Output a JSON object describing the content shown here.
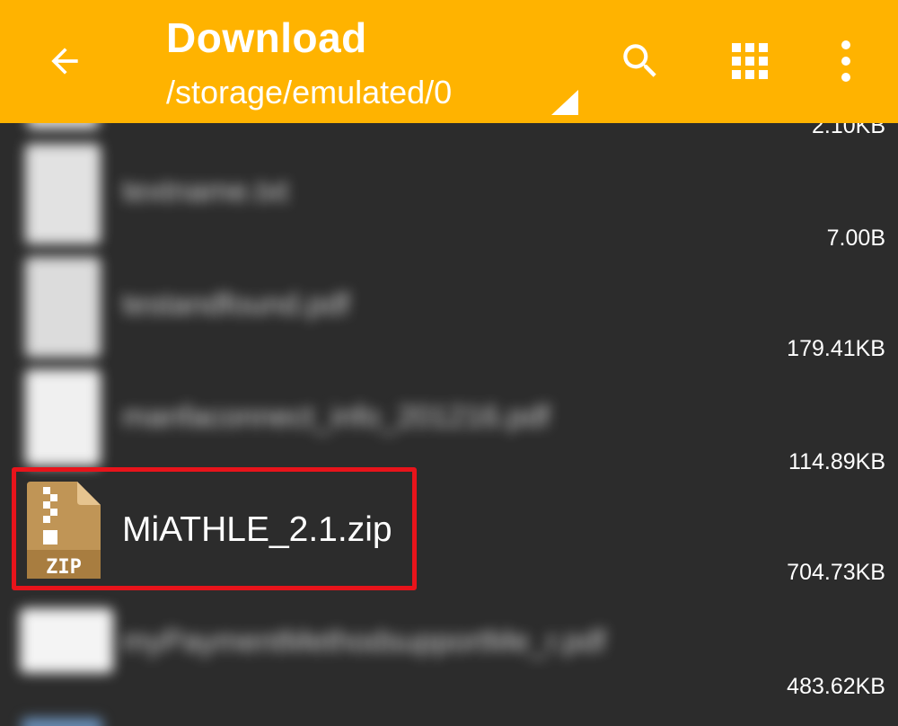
{
  "header": {
    "title": "Download",
    "path": "/storage/emulated/0",
    "back_icon": "arrow-back-icon",
    "search_icon": "search-icon",
    "view_icon": "grid-view-icon",
    "more_icon": "more-vert-icon",
    "accent_color": "#ffb300"
  },
  "files": [
    {
      "name": "",
      "size": "2.10KB",
      "blurred": true
    },
    {
      "name": "textname.txt",
      "size": "7.00B",
      "blurred": true
    },
    {
      "name": "testandfound.pdf",
      "size": "179.41KB",
      "blurred": true
    },
    {
      "name": "manfaconnect_info_201216.pdf",
      "size": "114.89KB",
      "blurred": true
    },
    {
      "name": "MiATHLE_2.1.zip",
      "size": "704.73KB",
      "blurred": false,
      "icon": "zip-file-icon",
      "icon_label": "ZIP",
      "highlighted": true
    },
    {
      "name": "myPaymentMethodsupportMe_r.pdf",
      "size": "483.62KB",
      "blurred": true
    }
  ],
  "highlight_color": "#e8141b"
}
